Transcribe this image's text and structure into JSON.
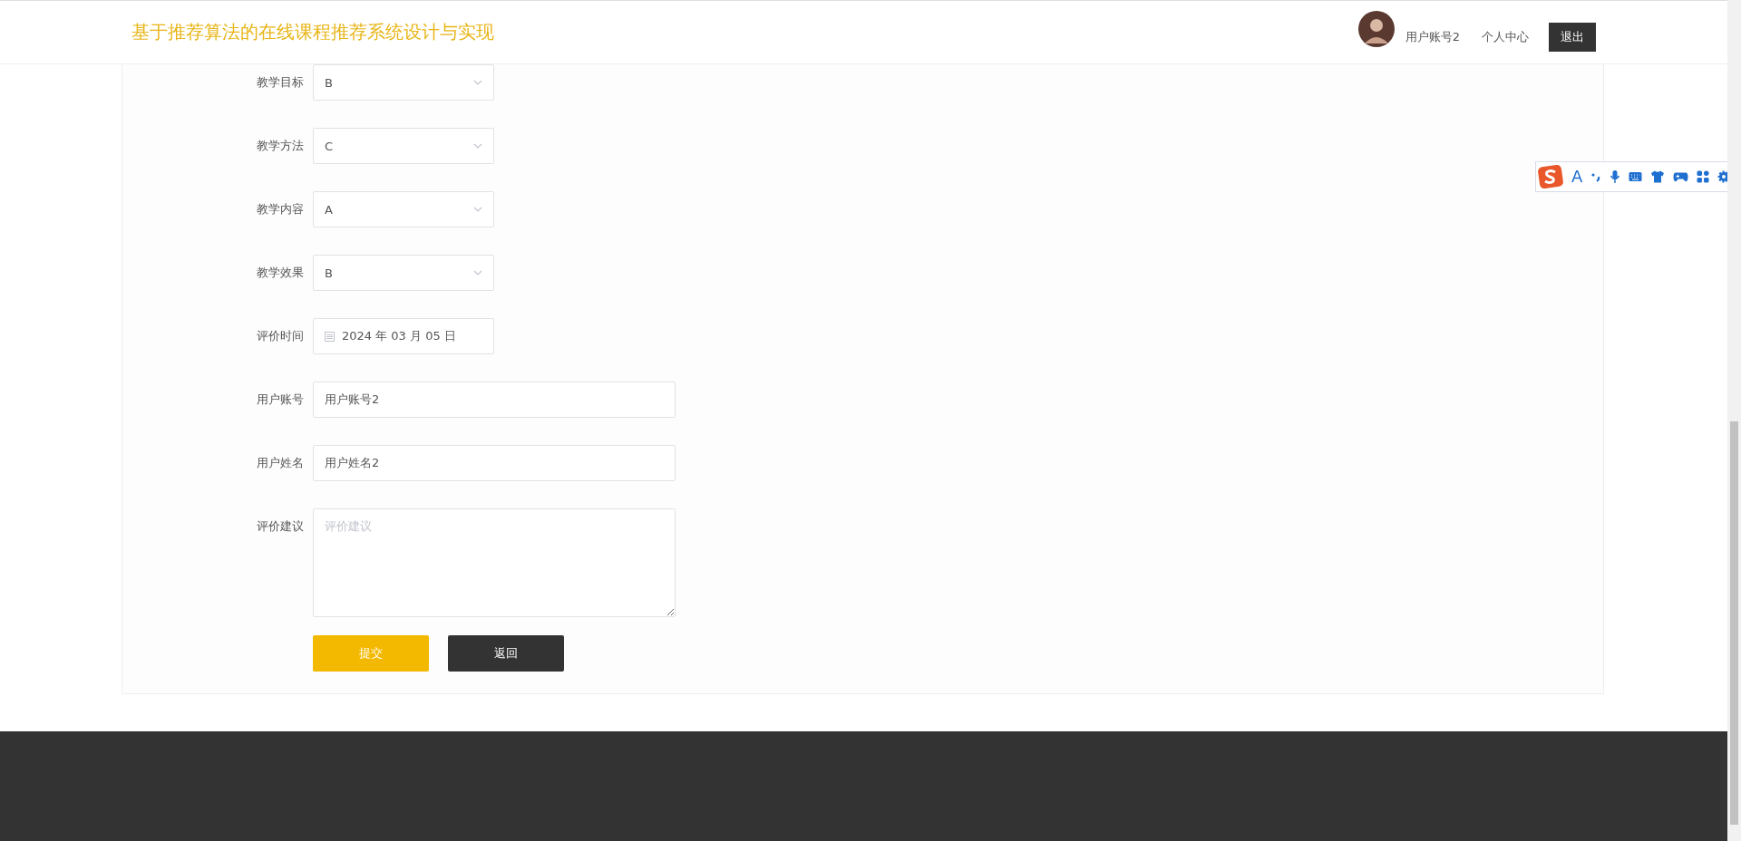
{
  "header": {
    "title": "基于推荐算法的在线课程推荐系统设计与实现",
    "user_name": "用户账号2",
    "profile_link": "个人中心",
    "logout_button": "退出"
  },
  "form": {
    "fields": [
      {
        "label": "教学目标",
        "kind": "select",
        "value": "B"
      },
      {
        "label": "教学方法",
        "kind": "select",
        "value": "C"
      },
      {
        "label": "教学内容",
        "kind": "select",
        "value": "A"
      },
      {
        "label": "教学效果",
        "kind": "select",
        "value": "B"
      },
      {
        "label": "评价时间",
        "kind": "date",
        "value": "2024 年 03 月 05 日"
      },
      {
        "label": "用户账号",
        "kind": "text",
        "value": "用户账号2"
      },
      {
        "label": "用户姓名",
        "kind": "text",
        "value": "用户姓名2"
      },
      {
        "label": "评价建议",
        "kind": "textarea",
        "placeholder": "评价建议"
      }
    ],
    "buttons": [
      {
        "label": "提交",
        "kind": "primary"
      },
      {
        "label": "返回",
        "kind": "secondary"
      }
    ]
  },
  "ime_toolbar": {
    "mode_label": "A"
  }
}
